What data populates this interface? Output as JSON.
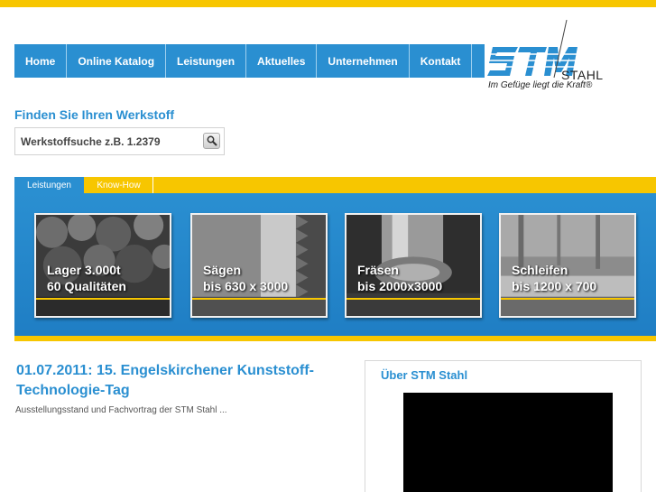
{
  "nav": {
    "items": [
      {
        "label": "Home"
      },
      {
        "label": "Online Katalog"
      },
      {
        "label": "Leistungen"
      },
      {
        "label": "Aktuelles"
      },
      {
        "label": "Unternehmen"
      },
      {
        "label": "Kontakt"
      }
    ]
  },
  "logo": {
    "brand": "STM",
    "name": "STAHL",
    "tagline": "Im Gefüge liegt die Kraft®"
  },
  "search": {
    "title": "Finden Sie Ihren Werkstoff",
    "placeholder": "Werkstoffsuche z.B. 1.2379"
  },
  "tabs": [
    {
      "label": "Leistungen",
      "active": true
    },
    {
      "label": "Know-How",
      "active": false
    }
  ],
  "cards": [
    {
      "line1": "Lager 3.000t",
      "line2": "60 Qualitäten"
    },
    {
      "line1": "Sägen",
      "line2": "bis 630 x 3000"
    },
    {
      "line1": "Fräsen",
      "line2": "bis 2000x3000"
    },
    {
      "line1": "Schleifen",
      "line2": "bis 1200 x 700"
    }
  ],
  "news": {
    "title": "01.07.2011: 15. Engelskirchener Kunststoff-Technologie-Tag",
    "subtitle": "Ausstellungsstand und Fachvortrag der STM Stahl ..."
  },
  "about": {
    "title": "Über STM Stahl"
  },
  "colors": {
    "accent_blue": "#2a8fd1",
    "accent_yellow": "#f7c600"
  },
  "icons": {
    "search_button": "magnifier-icon"
  }
}
